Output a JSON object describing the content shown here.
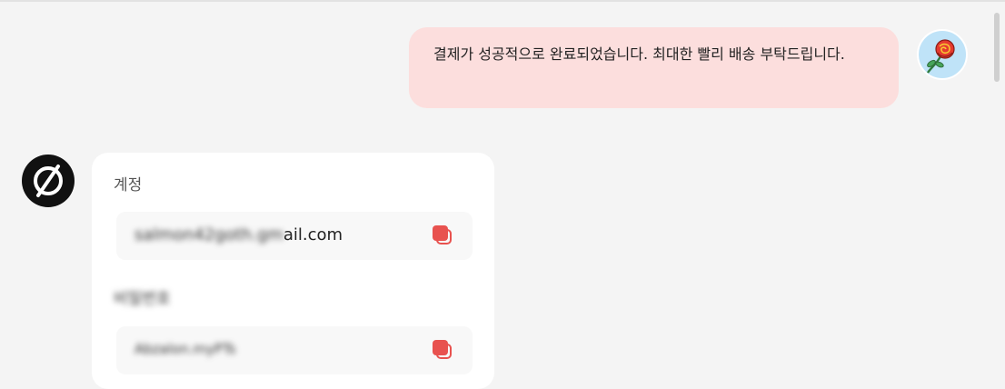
{
  "chat": {
    "user_message": "결제가 성공적으로 완료되었습니다. 최대한 빨리 배송 부탁드립니다.",
    "user_avatar_icon": "rose-icon",
    "bot_avatar_icon": "empty-set-logo-icon"
  },
  "account_card": {
    "account_label": "계정",
    "email_hidden": "salmon42goth.gm",
    "email_visible": "ail.com",
    "password_label": "비밀번호",
    "password_value": "Abzalon.myPTs",
    "copy_icon": "copy-icon",
    "copy_color": "#e8524f"
  },
  "colors": {
    "user_bubble": "#fcdedd",
    "background": "#f4f4f4",
    "card": "#ffffff"
  }
}
